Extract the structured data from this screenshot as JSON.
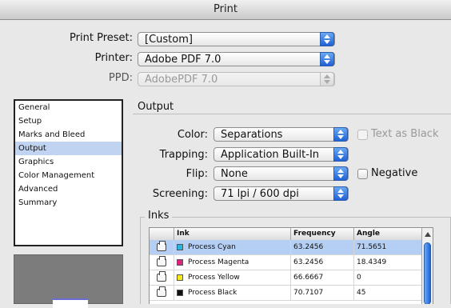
{
  "window": {
    "title": "Print"
  },
  "top_fields": [
    {
      "label": "Print Preset:",
      "value": "[Custom]",
      "enabled": true
    },
    {
      "label": "Printer:",
      "value": "Adobe PDF 7.0",
      "enabled": true
    },
    {
      "label": "PPD:",
      "value": "AdobePDF 7.0",
      "enabled": false
    }
  ],
  "sidebar": {
    "items": [
      {
        "label": "General"
      },
      {
        "label": "Setup"
      },
      {
        "label": "Marks and Bleed"
      },
      {
        "label": "Output",
        "selected": true
      },
      {
        "label": "Graphics"
      },
      {
        "label": "Color Management"
      },
      {
        "label": "Advanced"
      },
      {
        "label": "Summary"
      }
    ]
  },
  "output": {
    "section_title": "Output",
    "color": {
      "label": "Color:",
      "value": "Separations"
    },
    "text_as_black": {
      "label": "Text as Black",
      "checked": false,
      "enabled": false
    },
    "trapping": {
      "label": "Trapping:",
      "value": "Application Built-In"
    },
    "flip": {
      "label": "Flip:",
      "value": "None"
    },
    "negative": {
      "label": "Negative",
      "checked": false,
      "enabled": true
    },
    "screening": {
      "label": "Screening:",
      "value": "71 lpi / 600 dpi"
    }
  },
  "inks": {
    "group_title": "Inks",
    "columns": [
      "Ink",
      "Frequency",
      "Angle"
    ],
    "rows": [
      {
        "ink": "Process Cyan",
        "swatch": "#27b5df",
        "frequency": "63.2456",
        "angle": "71.5651",
        "selected": true
      },
      {
        "ink": "Process Magenta",
        "swatch": "#e0237f",
        "frequency": "63.2456",
        "angle": "18.4349"
      },
      {
        "ink": "Process Yellow",
        "swatch": "#f7ea18",
        "frequency": "66.6667",
        "angle": "0"
      },
      {
        "ink": "Process Black",
        "swatch": "#111111",
        "frequency": "70.7107",
        "angle": "45"
      }
    ]
  }
}
